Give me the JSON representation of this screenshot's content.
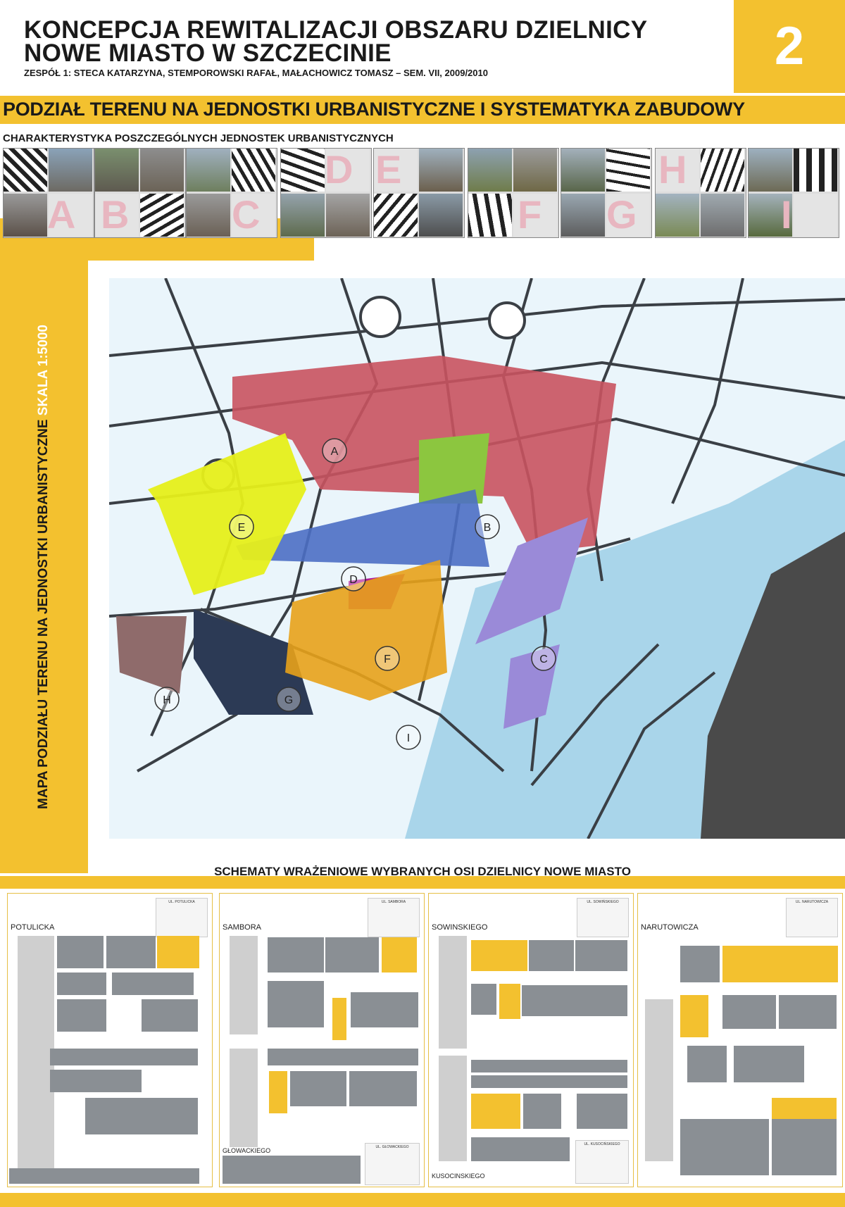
{
  "header": {
    "title_line1": "KONCEPCJA REWITALIZACJI OBSZARU DZIELNICY",
    "title_line2": "NOWE MIASTO W SZCZECINIE",
    "authors": "ZESPÓŁ 1: STECA KATARZYNA, STEMPOROWSKI RAFAŁ, MAŁACHOWICZ TOMASZ – SEM. VII, 2009/2010",
    "board_number": "2"
  },
  "banner": {
    "title": "PODZIAŁ TERENU NA JEDNOSTKI URBANISTYCZNE I SYSTEMATYKA ZABUDOWY"
  },
  "units_section": {
    "title": "CHARAKTERYSTYKA POSZCZEGÓLNYCH JEDNOSTEK URBANISTYCZNYCH",
    "units": [
      "A",
      "B",
      "C",
      "D",
      "E",
      "F",
      "G",
      "H",
      "I"
    ]
  },
  "map": {
    "side_title": "MAPA PODZIAŁU TERENU NA JEDNOSTKI URBANISTYCZNE",
    "scale": "SKALA 1:5000",
    "labels": [
      {
        "letter": "A",
        "color": "#c9535f"
      },
      {
        "letter": "B",
        "color": "#8cc63f"
      },
      {
        "letter": "C",
        "color": "#9a8ad8"
      },
      {
        "letter": "D",
        "color": "#4d6fc4"
      },
      {
        "letter": "E",
        "color": "#e6ef1a"
      },
      {
        "letter": "F",
        "color": "#b0189a"
      },
      {
        "letter": "G",
        "color": "#2c3a55"
      },
      {
        "letter": "H",
        "color": "#8f6b6b"
      },
      {
        "letter": "I",
        "color": "#e8a21a"
      }
    ]
  },
  "schematy": {
    "title": "SCHEMATY WRAŻENIOWE WYBRANYCH OSI DZIELNICY NOWE MIASTO",
    "panels": [
      {
        "street": "POTULICKA",
        "chart_label": "UL. POTULICKA"
      },
      {
        "street": "SAMBORA",
        "street2": "GŁOWACKIEGO",
        "chart_label": "UL. SAMBORA",
        "chart2_label": "UL. GŁOWACKIEGO"
      },
      {
        "street": "SOWINSKIEGO",
        "street2": "KUSOCINSKIEGO",
        "chart_label": "UL. SOWIŃSKIEGO",
        "chart2_label": "UL. KUSOCIŃSKIEGO"
      },
      {
        "street": "NARUTOWICZA",
        "chart_label": "UL. NARUTOWICZA"
      }
    ]
  },
  "colors": {
    "accent": "#f3c12f",
    "map_water": "#a9d5ea",
    "river": "#4a4a4a"
  }
}
